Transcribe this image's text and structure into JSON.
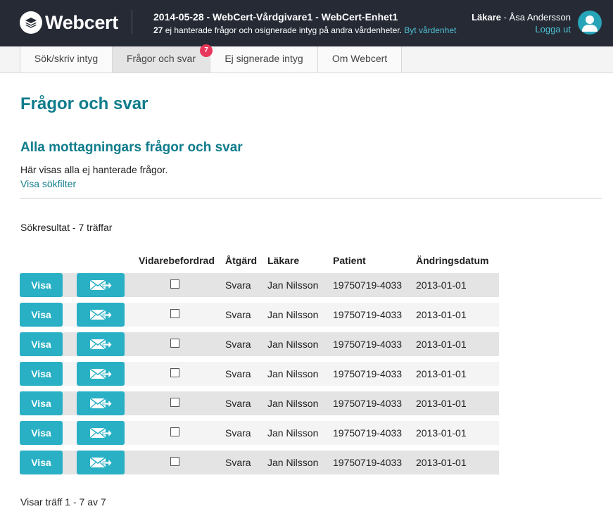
{
  "header": {
    "logo_text": "Webcert",
    "title": "2014-05-28 - WebCert-Vårdgivare1 - WebCert-Enhet1",
    "unhandled_count": "27",
    "unhandled_text": "ej hanterade frågor och osignerade intyg på andra vårdenheter.",
    "change_unit_link": "Byt vårdenhet",
    "user_role": "Läkare",
    "user_separator": " - ",
    "user_name": "Åsa Andersson",
    "logout_label": "Logga ut"
  },
  "tabs": [
    {
      "label": "Sök/skriv intyg"
    },
    {
      "label": "Frågor och svar",
      "badge": "7"
    },
    {
      "label": "Ej signerade intyg"
    },
    {
      "label": "Om Webcert"
    }
  ],
  "main": {
    "page_title": "Frågor och svar",
    "section_title": "Alla mottagningars frågor och svar",
    "section_description": "Här visas alla ej hanterade frågor.",
    "filter_link": "Visa sökfilter",
    "result_count": "Sökresultat - 7 träffar",
    "footer_text": "Visar träff 1 - 7 av 7"
  },
  "table": {
    "headers": [
      "Vidarebefordrad",
      "Åtgärd",
      "Läkare",
      "Patient",
      "Ändringsdatum"
    ],
    "view_button_label": "Visa",
    "forward_icon": "forward-mail-icon",
    "rows": [
      {
        "forwarded": false,
        "action": "Svara",
        "doctor": "Jan Nilsson",
        "patient": "19750719-4033",
        "date": "2013-01-01"
      },
      {
        "forwarded": false,
        "action": "Svara",
        "doctor": "Jan Nilsson",
        "patient": "19750719-4033",
        "date": "2013-01-01"
      },
      {
        "forwarded": false,
        "action": "Svara",
        "doctor": "Jan Nilsson",
        "patient": "19750719-4033",
        "date": "2013-01-01"
      },
      {
        "forwarded": false,
        "action": "Svara",
        "doctor": "Jan Nilsson",
        "patient": "19750719-4033",
        "date": "2013-01-01"
      },
      {
        "forwarded": false,
        "action": "Svara",
        "doctor": "Jan Nilsson",
        "patient": "19750719-4033",
        "date": "2013-01-01"
      },
      {
        "forwarded": false,
        "action": "Svara",
        "doctor": "Jan Nilsson",
        "patient": "19750719-4033",
        "date": "2013-01-01"
      },
      {
        "forwarded": false,
        "action": "Svara",
        "doctor": "Jan Nilsson",
        "patient": "19750719-4033",
        "date": "2013-01-01"
      }
    ]
  },
  "colors": {
    "header_bg": "#252a35",
    "accent": "#29b0c5",
    "heading": "#0f7c8c",
    "link": "#4fc1d4",
    "badge": "#e8375b"
  }
}
